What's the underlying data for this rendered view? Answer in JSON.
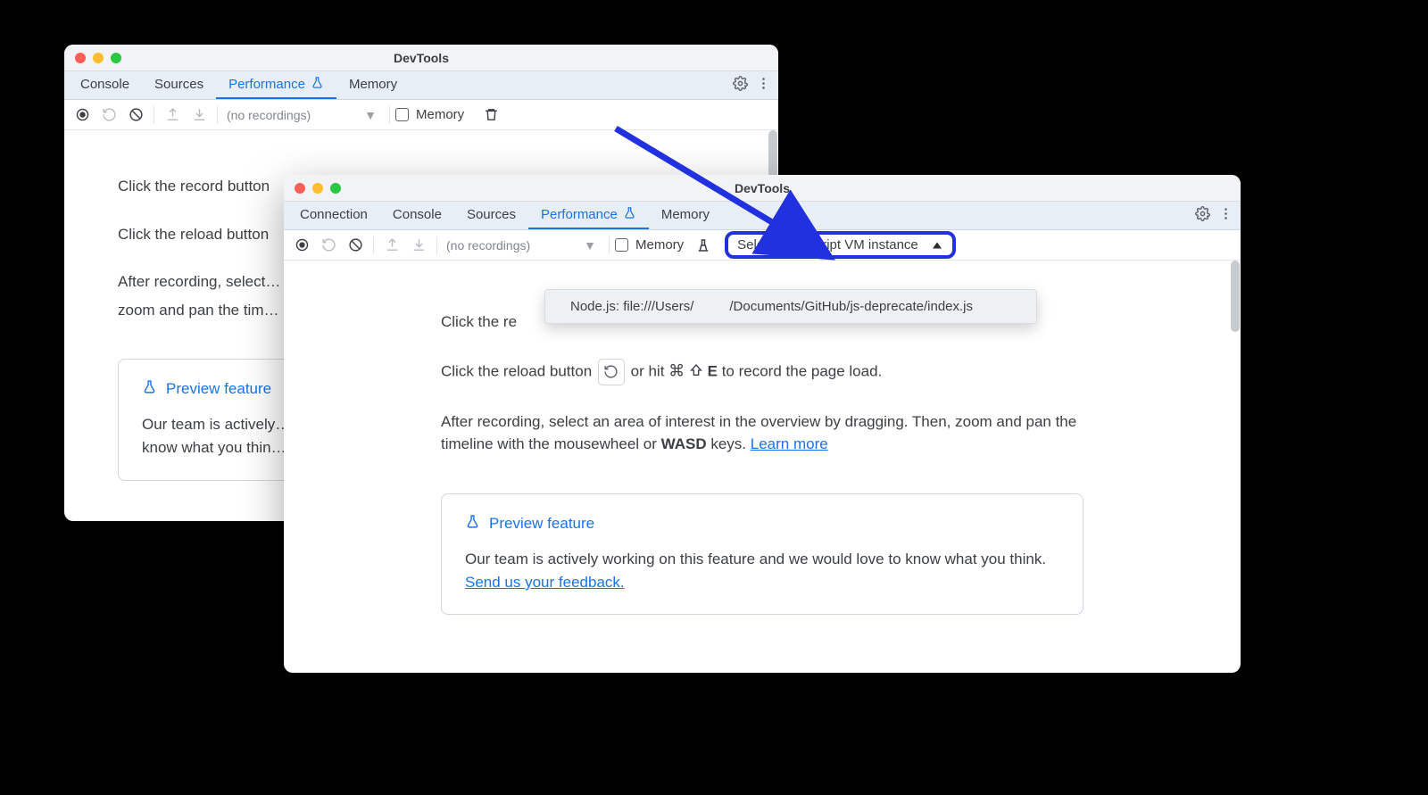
{
  "windowA": {
    "title": "DevTools",
    "tabs": [
      "Console",
      "Sources",
      "Performance",
      "Memory"
    ],
    "active_tab": 2,
    "toolbar": {
      "recordings_label": "(no recordings)",
      "memory_label": "Memory"
    },
    "instructions": {
      "record_prefix": "Click the record button",
      "reload_prefix": "Click the reload button",
      "after": "After recording, select…",
      "zoom": "zoom and pan the tim…"
    },
    "card": {
      "title": "Preview feature",
      "body_prefix": "Our team is actively…",
      "body_break": "know what you thin…"
    }
  },
  "windowB": {
    "title": "DevTools",
    "tabs": [
      "Connection",
      "Console",
      "Sources",
      "Performance",
      "Memory"
    ],
    "active_tab": 3,
    "toolbar": {
      "recordings_label": "(no recordings)",
      "memory_label": "Memory",
      "vm_select_label": "Select JavaScript VM instance"
    },
    "dropdown": {
      "prefix": "Node.js: file:///Users/",
      "suffix": "/Documents/GitHub/js-deprecate/index.js"
    },
    "instructions": {
      "record_prefix": "Click the re",
      "reload_prefix": "Click the reload button ",
      "reload_suffix_a": " or hit ",
      "reload_key_cmd": "⌘",
      "reload_key_letter": "E",
      "reload_suffix_b": " to record the page load.",
      "after_a": "After recording, select an area of interest in the overview by dragging. Then, zoom and pan the timeline with the mousewheel or ",
      "wasd": "WASD",
      "after_b": " keys. ",
      "learn_more": "Learn more"
    },
    "card": {
      "title": "Preview feature",
      "body_a": "Our team is actively working on this feature and we would love to know what you think. ",
      "feedback": "Send us your feedback."
    }
  }
}
